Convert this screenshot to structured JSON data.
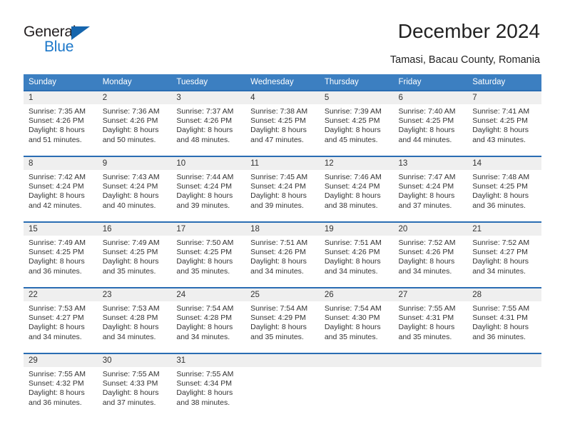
{
  "brand": {
    "logo_top": "General",
    "logo_bottom": "Blue",
    "logo_color_dark": "#231f20",
    "logo_color_blue": "#1b77c9"
  },
  "header": {
    "title": "December 2024",
    "subtitle": "Tamasi, Bacau County, Romania"
  },
  "theme": {
    "header_row_bg": "#3c7fc1",
    "week_separator": "#2a6db3",
    "daynum_bg": "#efefef",
    "text": "#333333"
  },
  "weekday_headers": [
    "Sunday",
    "Monday",
    "Tuesday",
    "Wednesday",
    "Thursday",
    "Friday",
    "Saturday"
  ],
  "weeks": [
    {
      "days": [
        {
          "date": "1",
          "sunrise": "Sunrise: 7:35 AM",
          "sunset": "Sunset: 4:26 PM",
          "daylight_1": "Daylight: 8 hours",
          "daylight_2": "and 51 minutes."
        },
        {
          "date": "2",
          "sunrise": "Sunrise: 7:36 AM",
          "sunset": "Sunset: 4:26 PM",
          "daylight_1": "Daylight: 8 hours",
          "daylight_2": "and 50 minutes."
        },
        {
          "date": "3",
          "sunrise": "Sunrise: 7:37 AM",
          "sunset": "Sunset: 4:26 PM",
          "daylight_1": "Daylight: 8 hours",
          "daylight_2": "and 48 minutes."
        },
        {
          "date": "4",
          "sunrise": "Sunrise: 7:38 AM",
          "sunset": "Sunset: 4:25 PM",
          "daylight_1": "Daylight: 8 hours",
          "daylight_2": "and 47 minutes."
        },
        {
          "date": "5",
          "sunrise": "Sunrise: 7:39 AM",
          "sunset": "Sunset: 4:25 PM",
          "daylight_1": "Daylight: 8 hours",
          "daylight_2": "and 45 minutes."
        },
        {
          "date": "6",
          "sunrise": "Sunrise: 7:40 AM",
          "sunset": "Sunset: 4:25 PM",
          "daylight_1": "Daylight: 8 hours",
          "daylight_2": "and 44 minutes."
        },
        {
          "date": "7",
          "sunrise": "Sunrise: 7:41 AM",
          "sunset": "Sunset: 4:25 PM",
          "daylight_1": "Daylight: 8 hours",
          "daylight_2": "and 43 minutes."
        }
      ]
    },
    {
      "days": [
        {
          "date": "8",
          "sunrise": "Sunrise: 7:42 AM",
          "sunset": "Sunset: 4:24 PM",
          "daylight_1": "Daylight: 8 hours",
          "daylight_2": "and 42 minutes."
        },
        {
          "date": "9",
          "sunrise": "Sunrise: 7:43 AM",
          "sunset": "Sunset: 4:24 PM",
          "daylight_1": "Daylight: 8 hours",
          "daylight_2": "and 40 minutes."
        },
        {
          "date": "10",
          "sunrise": "Sunrise: 7:44 AM",
          "sunset": "Sunset: 4:24 PM",
          "daylight_1": "Daylight: 8 hours",
          "daylight_2": "and 39 minutes."
        },
        {
          "date": "11",
          "sunrise": "Sunrise: 7:45 AM",
          "sunset": "Sunset: 4:24 PM",
          "daylight_1": "Daylight: 8 hours",
          "daylight_2": "and 39 minutes."
        },
        {
          "date": "12",
          "sunrise": "Sunrise: 7:46 AM",
          "sunset": "Sunset: 4:24 PM",
          "daylight_1": "Daylight: 8 hours",
          "daylight_2": "and 38 minutes."
        },
        {
          "date": "13",
          "sunrise": "Sunrise: 7:47 AM",
          "sunset": "Sunset: 4:24 PM",
          "daylight_1": "Daylight: 8 hours",
          "daylight_2": "and 37 minutes."
        },
        {
          "date": "14",
          "sunrise": "Sunrise: 7:48 AM",
          "sunset": "Sunset: 4:25 PM",
          "daylight_1": "Daylight: 8 hours",
          "daylight_2": "and 36 minutes."
        }
      ]
    },
    {
      "days": [
        {
          "date": "15",
          "sunrise": "Sunrise: 7:49 AM",
          "sunset": "Sunset: 4:25 PM",
          "daylight_1": "Daylight: 8 hours",
          "daylight_2": "and 36 minutes."
        },
        {
          "date": "16",
          "sunrise": "Sunrise: 7:49 AM",
          "sunset": "Sunset: 4:25 PM",
          "daylight_1": "Daylight: 8 hours",
          "daylight_2": "and 35 minutes."
        },
        {
          "date": "17",
          "sunrise": "Sunrise: 7:50 AM",
          "sunset": "Sunset: 4:25 PM",
          "daylight_1": "Daylight: 8 hours",
          "daylight_2": "and 35 minutes."
        },
        {
          "date": "18",
          "sunrise": "Sunrise: 7:51 AM",
          "sunset": "Sunset: 4:26 PM",
          "daylight_1": "Daylight: 8 hours",
          "daylight_2": "and 34 minutes."
        },
        {
          "date": "19",
          "sunrise": "Sunrise: 7:51 AM",
          "sunset": "Sunset: 4:26 PM",
          "daylight_1": "Daylight: 8 hours",
          "daylight_2": "and 34 minutes."
        },
        {
          "date": "20",
          "sunrise": "Sunrise: 7:52 AM",
          "sunset": "Sunset: 4:26 PM",
          "daylight_1": "Daylight: 8 hours",
          "daylight_2": "and 34 minutes."
        },
        {
          "date": "21",
          "sunrise": "Sunrise: 7:52 AM",
          "sunset": "Sunset: 4:27 PM",
          "daylight_1": "Daylight: 8 hours",
          "daylight_2": "and 34 minutes."
        }
      ]
    },
    {
      "days": [
        {
          "date": "22",
          "sunrise": "Sunrise: 7:53 AM",
          "sunset": "Sunset: 4:27 PM",
          "daylight_1": "Daylight: 8 hours",
          "daylight_2": "and 34 minutes."
        },
        {
          "date": "23",
          "sunrise": "Sunrise: 7:53 AM",
          "sunset": "Sunset: 4:28 PM",
          "daylight_1": "Daylight: 8 hours",
          "daylight_2": "and 34 minutes."
        },
        {
          "date": "24",
          "sunrise": "Sunrise: 7:54 AM",
          "sunset": "Sunset: 4:28 PM",
          "daylight_1": "Daylight: 8 hours",
          "daylight_2": "and 34 minutes."
        },
        {
          "date": "25",
          "sunrise": "Sunrise: 7:54 AM",
          "sunset": "Sunset: 4:29 PM",
          "daylight_1": "Daylight: 8 hours",
          "daylight_2": "and 35 minutes."
        },
        {
          "date": "26",
          "sunrise": "Sunrise: 7:54 AM",
          "sunset": "Sunset: 4:30 PM",
          "daylight_1": "Daylight: 8 hours",
          "daylight_2": "and 35 minutes."
        },
        {
          "date": "27",
          "sunrise": "Sunrise: 7:55 AM",
          "sunset": "Sunset: 4:31 PM",
          "daylight_1": "Daylight: 8 hours",
          "daylight_2": "and 35 minutes."
        },
        {
          "date": "28",
          "sunrise": "Sunrise: 7:55 AM",
          "sunset": "Sunset: 4:31 PM",
          "daylight_1": "Daylight: 8 hours",
          "daylight_2": "and 36 minutes."
        }
      ]
    },
    {
      "days": [
        {
          "date": "29",
          "sunrise": "Sunrise: 7:55 AM",
          "sunset": "Sunset: 4:32 PM",
          "daylight_1": "Daylight: 8 hours",
          "daylight_2": "and 36 minutes."
        },
        {
          "date": "30",
          "sunrise": "Sunrise: 7:55 AM",
          "sunset": "Sunset: 4:33 PM",
          "daylight_1": "Daylight: 8 hours",
          "daylight_2": "and 37 minutes."
        },
        {
          "date": "31",
          "sunrise": "Sunrise: 7:55 AM",
          "sunset": "Sunset: 4:34 PM",
          "daylight_1": "Daylight: 8 hours",
          "daylight_2": "and 38 minutes."
        },
        {
          "date": "",
          "sunrise": "",
          "sunset": "",
          "daylight_1": "",
          "daylight_2": ""
        },
        {
          "date": "",
          "sunrise": "",
          "sunset": "",
          "daylight_1": "",
          "daylight_2": ""
        },
        {
          "date": "",
          "sunrise": "",
          "sunset": "",
          "daylight_1": "",
          "daylight_2": ""
        },
        {
          "date": "",
          "sunrise": "",
          "sunset": "",
          "daylight_1": "",
          "daylight_2": ""
        }
      ]
    }
  ]
}
